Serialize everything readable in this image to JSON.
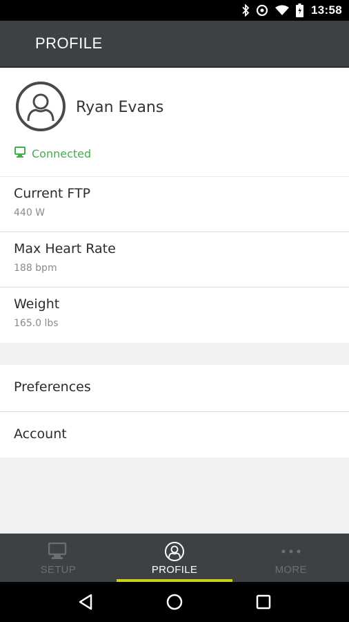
{
  "status_bar": {
    "time": "13:58",
    "icons": [
      "bluetooth-icon",
      "data-saver-icon",
      "wifi-icon",
      "battery-icon"
    ]
  },
  "app_bar": {
    "title": "PROFILE"
  },
  "profile": {
    "name": "Ryan Evans",
    "connection_status": "Connected",
    "status_color": "#3fb04a"
  },
  "stats": [
    {
      "label": "Current FTP",
      "value": "440 W"
    },
    {
      "label": "Max Heart Rate",
      "value": "188 bpm"
    },
    {
      "label": "Weight",
      "value": "165.0 lbs"
    }
  ],
  "menu": [
    {
      "label": "Preferences"
    },
    {
      "label": "Account"
    }
  ],
  "bottom_nav": {
    "tabs": [
      {
        "label": "SETUP",
        "icon": "monitor-icon",
        "active": false
      },
      {
        "label": "PROFILE",
        "icon": "profile-icon",
        "active": true
      },
      {
        "label": "MORE",
        "icon": "more-dots-icon",
        "active": false
      }
    ],
    "active_indicator_color": "#c9d31a"
  },
  "system_nav": [
    "back-icon",
    "home-icon",
    "recents-icon"
  ]
}
